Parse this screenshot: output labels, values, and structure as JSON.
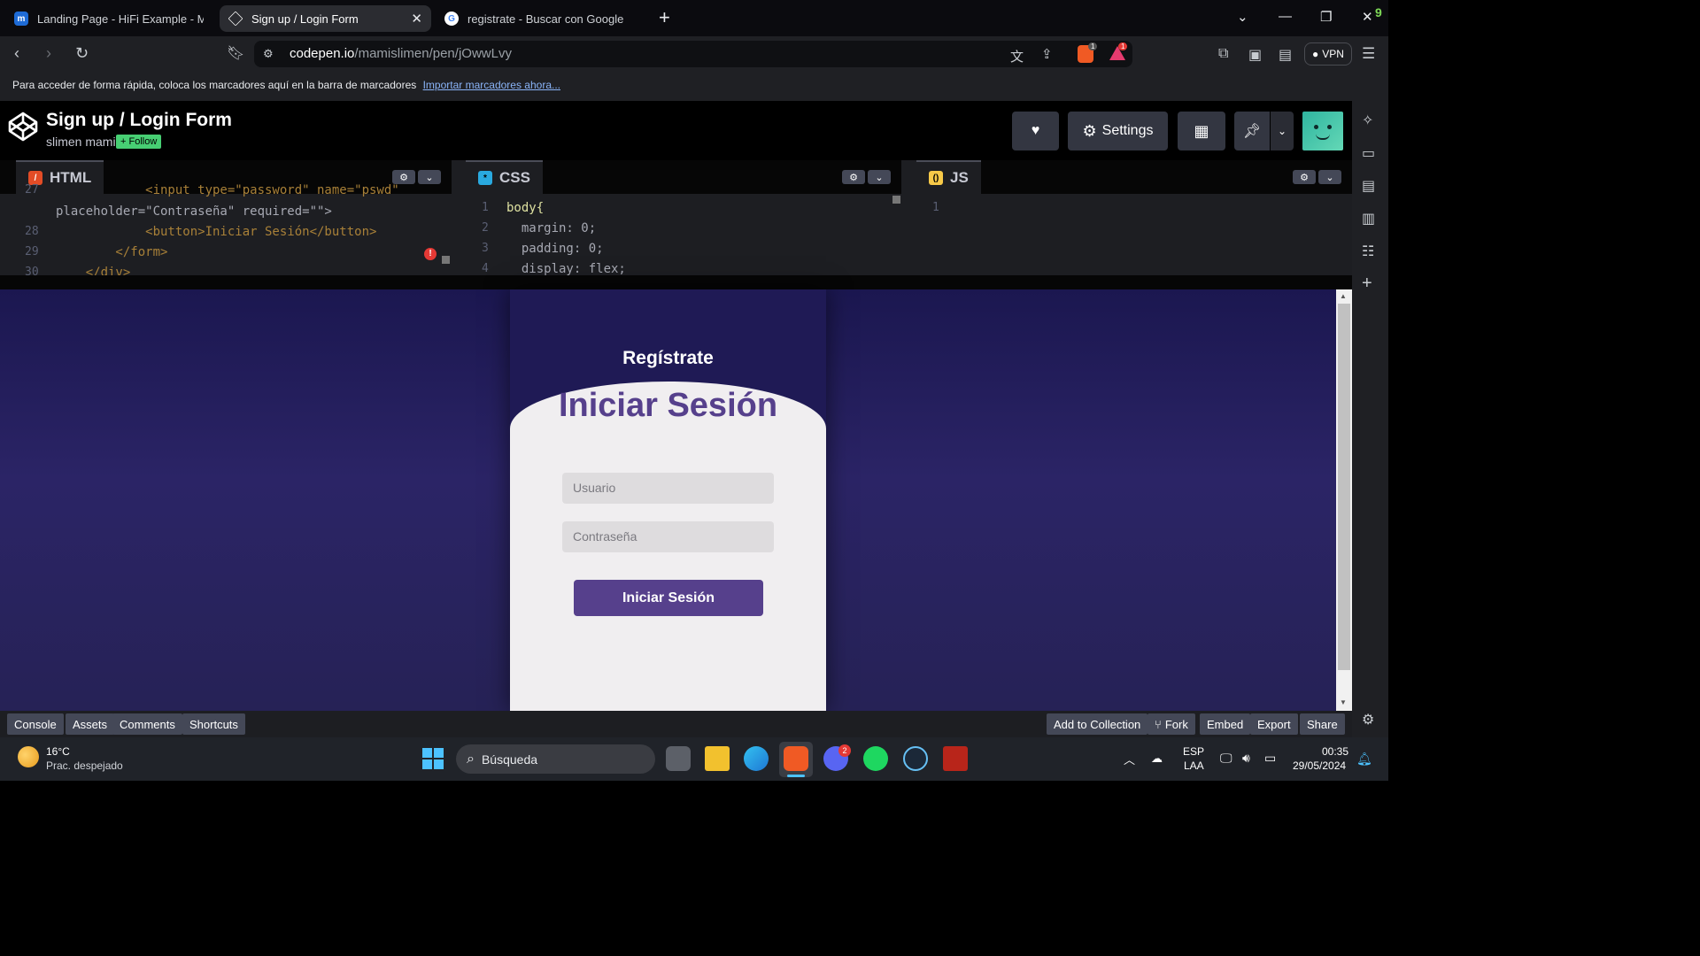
{
  "browser": {
    "tabs": [
      {
        "title": "Landing Page - HiFi Example - Moqups",
        "active": false
      },
      {
        "title": "Sign up / Login Form",
        "active": true
      },
      {
        "title": "registrate - Buscar con Google",
        "active": false
      }
    ],
    "url_host": "codepen.io",
    "url_path": "/mamislimen/pen/jOwwLvy",
    "vpn_label": "VPN",
    "brave_badge": "1",
    "alert_badge": "1",
    "corner_badge": "9"
  },
  "bookmarks": {
    "hint": "Para acceder de forma rápida, coloca los marcadores aquí en la barra de marcadores",
    "import_link": "Importar marcadores ahora..."
  },
  "codepen": {
    "title": "Sign up / Login Form",
    "author": "slimen mami",
    "follow": "+ Follow",
    "settings": "Settings"
  },
  "editors": {
    "html": {
      "label": "HTML",
      "lines": [
        {
          "n": "27",
          "code": "            <input type=\"password\" name=\"pswd\""
        },
        {
          "n": "",
          "code": "placeholder=\"Contraseña\" required=\"\">"
        },
        {
          "n": "28",
          "code": "            <button>Iniciar Sesión</button>"
        },
        {
          "n": "29",
          "code": "        </form>"
        },
        {
          "n": "30",
          "code": "    </div>"
        }
      ]
    },
    "css": {
      "label": "CSS",
      "lines": [
        {
          "n": "1",
          "code": "body{"
        },
        {
          "n": "2",
          "code": "  margin: 0;"
        },
        {
          "n": "3",
          "code": "  padding: 0;"
        },
        {
          "n": "4",
          "code": "  display: flex;"
        }
      ]
    },
    "js": {
      "label": "JS",
      "lines": [
        {
          "n": "1",
          "code": ""
        }
      ]
    }
  },
  "preview": {
    "signup_heading": "Regístrate",
    "login_heading": "Iniciar Sesión",
    "user_placeholder": "Usuario",
    "password_placeholder": "Contraseña",
    "submit_label": "Iniciar Sesión"
  },
  "footer": {
    "left": [
      "Console",
      "Assets",
      "Comments",
      "Shortcuts"
    ],
    "right": [
      "Add to Collection",
      "Fork",
      "Embed",
      "Export",
      "Share"
    ]
  },
  "taskbar": {
    "temp": "16°C",
    "weather": "Prac. despejado",
    "search_placeholder": "Búsqueda",
    "lang1": "ESP",
    "lang2": "LAA",
    "time": "00:35",
    "date": "29/05/2024",
    "discord_badge": "2"
  },
  "colors": {
    "accent_purple": "#56408c",
    "codepen_follow": "#47cf73",
    "preview_bg": "#241f5c"
  }
}
